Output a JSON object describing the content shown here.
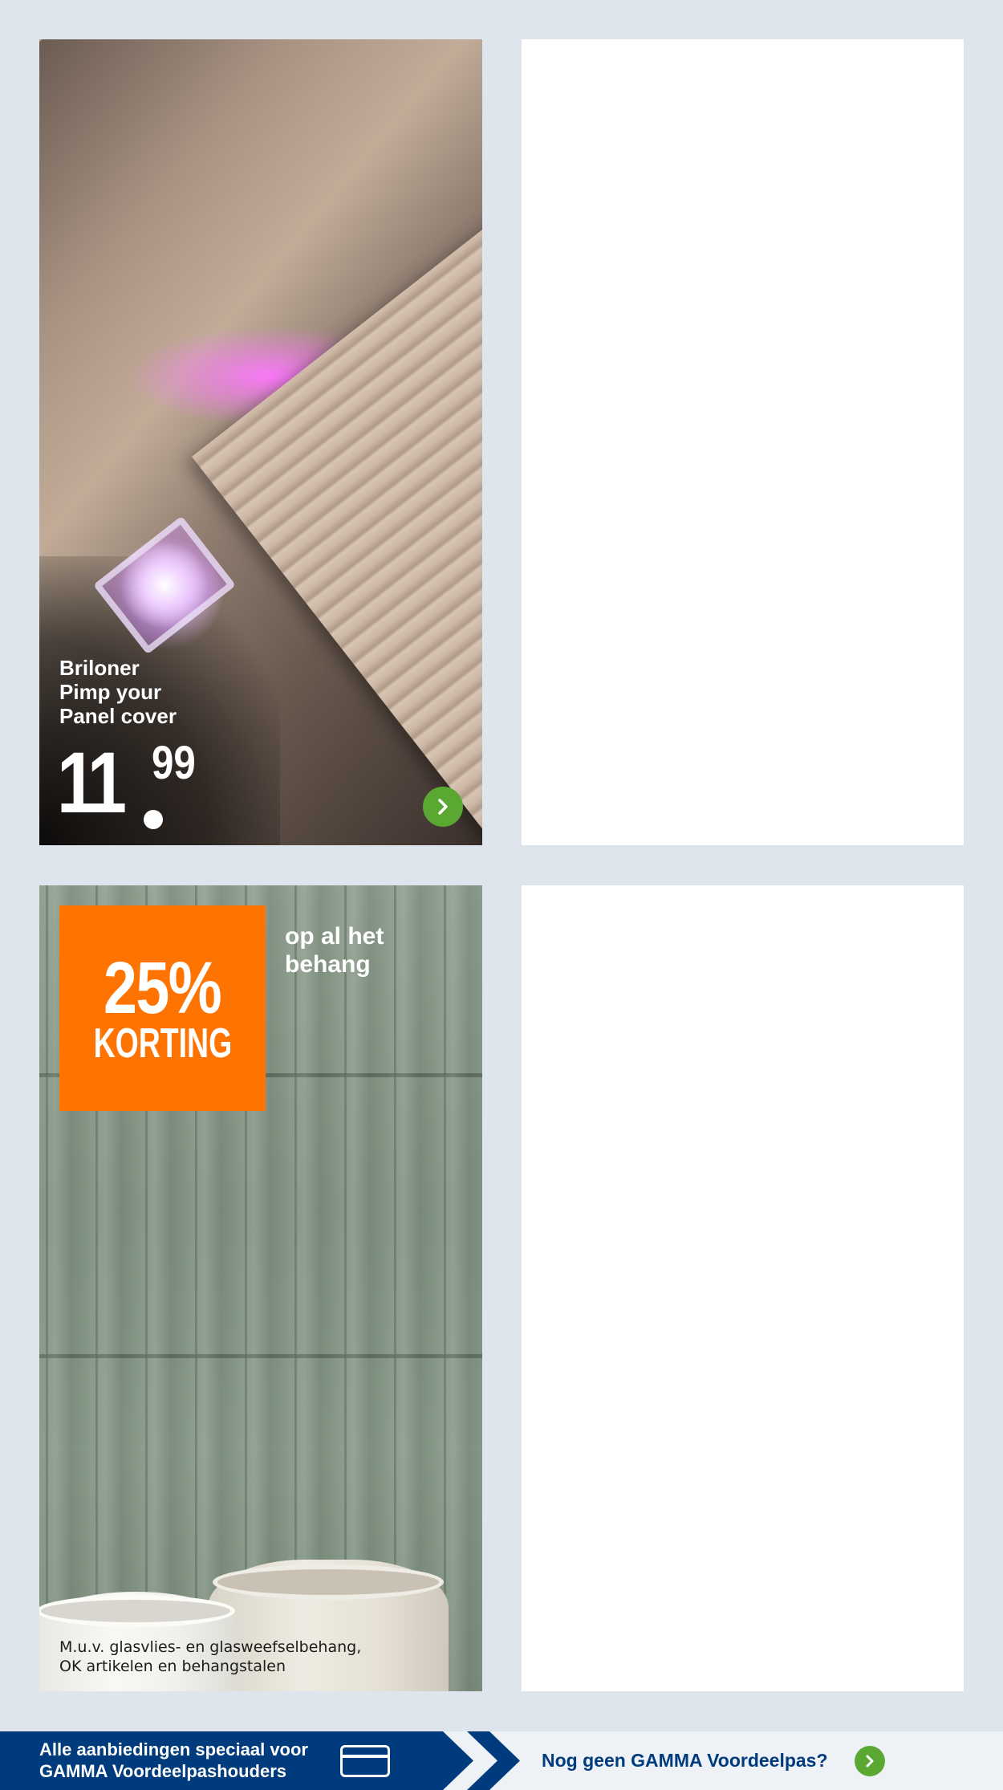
{
  "promo_cards": [
    {
      "product_name": "Briloner\nPimp your\nPanel cover",
      "price_integer": "11",
      "price_cents": "99",
      "button_icon": "chevron-right-icon"
    },
    {
      "badge_percent": "25%",
      "badge_label": "KORTING",
      "headline": "op al het\nbehang",
      "disclaimer": "M.u.v. glasvlies- en glasweefselbehang,\nOK artikelen en behangstalen"
    }
  ],
  "banner": {
    "left_text": "Alle aanbiedingen speciaal voor\nGAMMA Voordeelpashouders",
    "left_icon": "loyalty-card-icon",
    "right_text": "Nog geen GAMMA Voordeelpas?",
    "right_icon": "chevron-right-icon"
  },
  "colors": {
    "page_background": "#dfe5ec",
    "accent_orange": "#ff7300",
    "brand_blue": "#003c7d",
    "button_green": "#5aa832"
  }
}
